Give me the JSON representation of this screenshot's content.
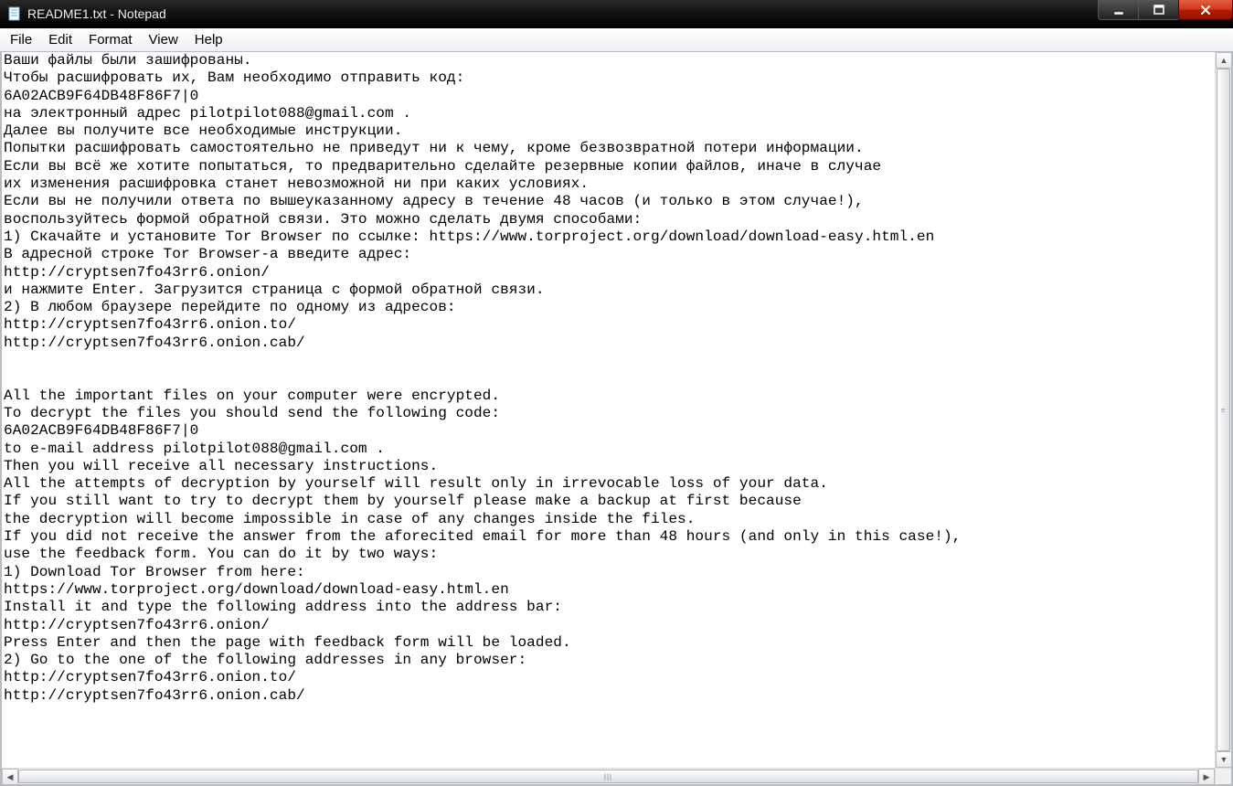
{
  "window": {
    "title": "README1.txt - Notepad"
  },
  "menu": {
    "file": "File",
    "edit": "Edit",
    "format": "Format",
    "view": "View",
    "help": "Help"
  },
  "icons": {
    "app": "notepad-icon",
    "minimize": "minimize-icon",
    "maximize": "maximize-icon",
    "close": "close-icon",
    "up": "▲",
    "down": "▼",
    "left": "◀",
    "right": "▶"
  },
  "document": {
    "text": "Ваши файлы были зашифрованы.\nЧтобы расшифровать их, Вам необходимо отправить код:\n6A02ACB9F64DB48F86F7|0\nна электронный адрес pilotpilot088@gmail.com .\nДалее вы получите все необходимые инструкции.\nПопытки расшифровать самостоятельно не приведут ни к чему, кроме безвозвратной потери информации.\nЕсли вы всё же хотите попытаться, то предварительно сделайте резервные копии файлов, иначе в случае\nих изменения расшифровка станет невозможной ни при каких условиях.\nЕсли вы не получили ответа по вышеуказанному адресу в течение 48 часов (и только в этом случае!),\nвоспользуйтесь формой обратной связи. Это можно сделать двумя способами:\n1) Скачайте и установите Tor Browser по ссылке: https://www.torproject.org/download/download-easy.html.en\nВ адресной строке Tor Browser-а введите адрес:\nhttp://cryptsen7fo43rr6.onion/\nи нажмите Enter. Загрузится страница с формой обратной связи.\n2) В любом браузере перейдите по одному из адресов:\nhttp://cryptsen7fo43rr6.onion.to/\nhttp://cryptsen7fo43rr6.onion.cab/\n\n\nAll the important files on your computer were encrypted.\nTo decrypt the files you should send the following code:\n6A02ACB9F64DB48F86F7|0\nto e-mail address pilotpilot088@gmail.com .\nThen you will receive all necessary instructions.\nAll the attempts of decryption by yourself will result only in irrevocable loss of your data.\nIf you still want to try to decrypt them by yourself please make a backup at first because\nthe decryption will become impossible in case of any changes inside the files.\nIf you did not receive the answer from the aforecited email for more than 48 hours (and only in this case!),\nuse the feedback form. You can do it by two ways:\n1) Download Tor Browser from here:\nhttps://www.torproject.org/download/download-easy.html.en\nInstall it and type the following address into the address bar:\nhttp://cryptsen7fo43rr6.onion/\nPress Enter and then the page with feedback form will be loaded.\n2) Go to the one of the following addresses in any browser:\nhttp://cryptsen7fo43rr6.onion.to/\nhttp://cryptsen7fo43rr6.onion.cab/"
  }
}
